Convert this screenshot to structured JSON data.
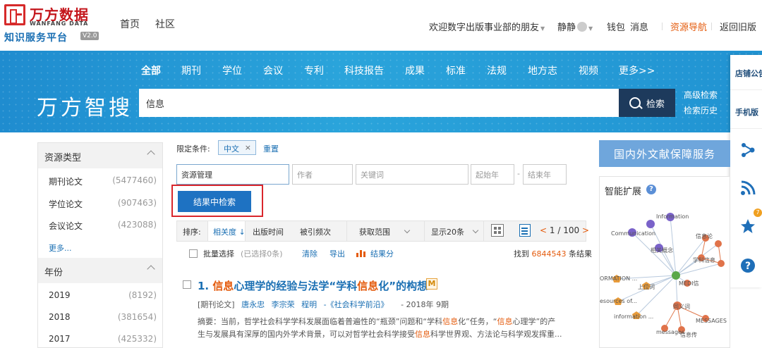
{
  "header": {
    "logo_cn": "万方数据",
    "logo_en": "WANFANG DATA",
    "logo_sub": "知识服务平台",
    "logo_ver": "V2.0",
    "nav": [
      "首页",
      "社区"
    ],
    "welcome": "欢迎数字出版事业部的朋友",
    "user": "静静",
    "wallet": "钱包",
    "messages": "消息",
    "resource_nav": "资源导航",
    "old_version": "返回旧版"
  },
  "banner": {
    "categories": [
      "全部",
      "期刊",
      "学位",
      "会议",
      "专利",
      "科技报告",
      "成果",
      "标准",
      "法规",
      "地方志",
      "视频",
      "更多>>"
    ],
    "brand": "万方智搜",
    "search_value": "信息",
    "search_btn": "检索",
    "advanced": "高级检索",
    "history": "检索历史"
  },
  "side_tools": {
    "announcement": "店铺公告",
    "mobile": "手机版",
    "badge": "7"
  },
  "left_panel": {
    "resource_type_title": "资源类型",
    "resource_types": [
      {
        "label": "期刊论文",
        "count": "(5477460)"
      },
      {
        "label": "学位论文",
        "count": "(907463)"
      },
      {
        "label": "会议论文",
        "count": "(423088)"
      }
    ],
    "more": "更多...",
    "year_title": "年份",
    "years": [
      {
        "label": "2019",
        "count": "(8192)"
      },
      {
        "label": "2018",
        "count": "(381654)"
      },
      {
        "label": "2017",
        "count": "(425332)"
      }
    ]
  },
  "filters": {
    "label": "限定条件:",
    "chip": "中文",
    "chip_close": "×",
    "reset": "重置",
    "field_value": "资源管理",
    "author_placeholder": "作者",
    "keyword_placeholder": "关键词",
    "start_year": "起始年",
    "dash": "-",
    "end_year": "结束年",
    "search_in_results": "结果中检索"
  },
  "sort": {
    "label": "排序:",
    "relevance": "相关度",
    "pub_time": "出版时间",
    "citations": "被引频次",
    "scope": "获取范围",
    "show": "显示20条",
    "page": "1 / 100",
    "prev": "<",
    "next": ">"
  },
  "bulk": {
    "select_all": "批量选择",
    "selected": "(已选择0条)",
    "clear": "清除",
    "export": "导出",
    "analyze": "结果分",
    "found_prefix": "找到",
    "found_count": "6844543",
    "found_suffix": "条结果"
  },
  "result": {
    "index": "1.",
    "title_parts": [
      "信息",
      "心理学的经验与法学“学科",
      "信息",
      "化”的构想"
    ],
    "badge": "M",
    "type": "[期刊论文]",
    "authors": [
      "唐永忠",
      "李宗荣",
      "程明"
    ],
    "journal": "-《社会科学前沿》",
    "year": "- 2018年 9期",
    "abstract_line1_parts": [
      "摘要：当前，哲学社会科学学科发展面临着普遍性的“瓶颈”问题和“学科",
      "信息",
      "化”任务，“",
      "信息",
      "心理学”的产"
    ],
    "abstract_line2_parts": [
      "生与发展具有深厚的国内外学术背景，可以对哲学社会科学接受",
      "信息",
      "科学世界观、方法论与科学观发挥重..."
    ]
  },
  "right_panel": {
    "service": "国内外文献保障服务",
    "smart_title": "智能扩展",
    "help": "?",
    "graph_labels": [
      "Information",
      "Communication",
      "相关概念",
      "信息论",
      "ORMATION ...",
      "学科信息",
      "上位词",
      "MEDI信",
      "esources of...",
      "information ...",
      "同义词",
      "MESSAGES",
      "messages",
      "信息传"
    ]
  },
  "colors": {
    "brand_red": "#c4161c",
    "banner_blue": "#2aa4db",
    "link_blue": "#1a6fb3",
    "highlight_orange": "#e45b0d",
    "search_btn": "#1d3a5c",
    "highlight_box": "#d9262c"
  }
}
